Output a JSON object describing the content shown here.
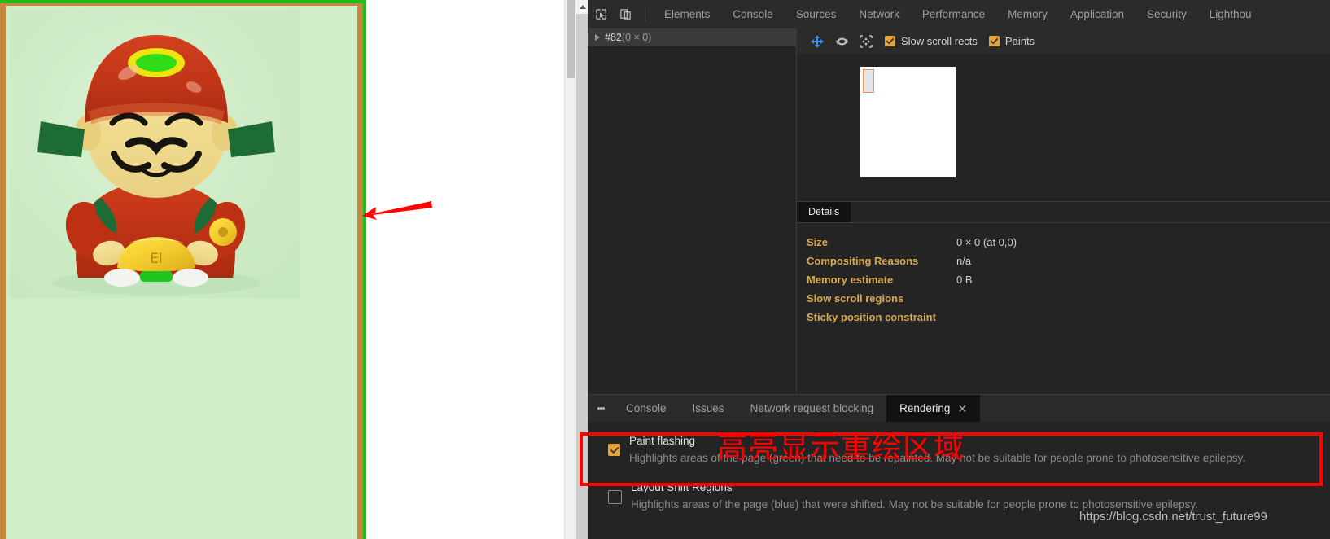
{
  "page": {
    "paint_flash_color": "#cdeec7",
    "paint_flash_border_color": "#18c018",
    "paint_flash_inner_border_color": "#c8873f",
    "photo_alt": "red-and-gold lucky figurine toy",
    "scrollbar": "page-vertical-scrollbar"
  },
  "devtools": {
    "tool_icons": [
      {
        "name": "inspect-element-icon",
        "title": "Inspect element"
      },
      {
        "name": "device-toolbar-icon",
        "title": "Toggle device toolbar"
      }
    ],
    "tabs": [
      {
        "label": "Elements",
        "active": false
      },
      {
        "label": "Console",
        "active": false
      },
      {
        "label": "Sources",
        "active": false
      },
      {
        "label": "Network",
        "active": false
      },
      {
        "label": "Performance",
        "active": false
      },
      {
        "label": "Memory",
        "active": false
      },
      {
        "label": "Application",
        "active": false
      },
      {
        "label": "Security",
        "active": false
      },
      {
        "label": "Lighthou",
        "active": false
      }
    ],
    "layers_tree": {
      "node_name": "#82",
      "node_dimensions": "(0 × 0)"
    },
    "layers_toolbar": {
      "icons": [
        {
          "name": "pan-mode-icon"
        },
        {
          "name": "rotate-mode-icon"
        },
        {
          "name": "reset-view-icon"
        }
      ],
      "checkboxes": [
        {
          "label": "Slow scroll rects",
          "checked": true
        },
        {
          "label": "Paints",
          "checked": true
        }
      ]
    },
    "details": {
      "tab_label": "Details",
      "rows": [
        {
          "key": "Size",
          "value": "0 × 0 (at 0,0)"
        },
        {
          "key": "Compositing Reasons",
          "value": "n/a"
        },
        {
          "key": "Memory estimate",
          "value": "0 B"
        },
        {
          "key": "Slow scroll regions",
          "value": ""
        },
        {
          "key": "Sticky position constraint",
          "value": ""
        }
      ]
    },
    "drawer": {
      "kebab_name": "more-tools-menu",
      "tabs": [
        {
          "label": "Console",
          "active": false,
          "closable": false
        },
        {
          "label": "Issues",
          "active": false,
          "closable": false
        },
        {
          "label": "Network request blocking",
          "active": false,
          "closable": false
        },
        {
          "label": "Rendering",
          "active": true,
          "closable": true,
          "close_glyph": "✕"
        }
      ],
      "rendering_items": [
        {
          "title": "Paint flashing",
          "description": "Highlights areas of the page (green) that need to be repainted. May not be suitable for people prone to photosensitive epilepsy.",
          "checked": true
        },
        {
          "title": "Layout Shift Regions",
          "description": "Highlights areas of the page (blue) that were shifted. May not be suitable for people prone to photosensitive epilepsy.",
          "checked": false
        }
      ]
    }
  },
  "annotations": {
    "chinese_note": "高亮显示重绘区域",
    "note_color": "#fe0000",
    "rect_color": "#fe0000",
    "arrow_color": "#fe0000",
    "watermark": "https://blog.csdn.net/trust_future99"
  }
}
